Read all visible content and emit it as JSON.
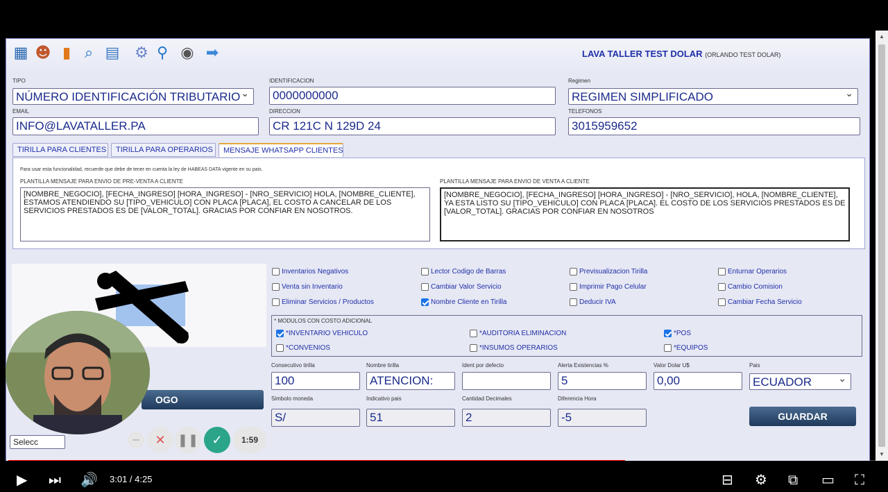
{
  "brand": {
    "title": "LAVA TALLER TEST DOLAR",
    "subtitle": "(ORLANDO TEST DOLAR)"
  },
  "toolbar_icons": [
    "cash-register-icon",
    "users-icon",
    "chart-icon",
    "search-icon",
    "calendar-icon",
    "gear-icon",
    "zoom-icon",
    "user-icon",
    "arrow-right-icon"
  ],
  "form": {
    "tipo": {
      "label": "TIPO",
      "value": "NÚMERO IDENTIFICACIÓN TRIBUTARIO"
    },
    "identificacion": {
      "label": "IDENTIFICACION",
      "value": "0000000000"
    },
    "regimen": {
      "label": "Regimen",
      "value": "REGIMEN SIMPLIFICADO"
    },
    "email": {
      "label": "EMAIL",
      "value": "INFO@LAVATALLER.PA"
    },
    "direccion": {
      "label": "DIRECCION",
      "value": "CR 121C N 129D 24"
    },
    "telefonos": {
      "label": "TELEFONOS",
      "value": "3015959652"
    }
  },
  "tabs": [
    "TIRILLA PARA CLIENTES",
    "TIRILLA PARA OPERARIOS",
    "MENSAJE WHATSAPP CLIENTES"
  ],
  "whatsapp": {
    "notice": "Para usar esta funcionalidad, recuerde que debe de tener en cuenta la ley de HABEAS DATA vigente en su pais.",
    "preventa_label": "PLANTILLA MENSAJE PARA ENVIO DE PRE-VENTA A CLIENTE",
    "preventa_text": "[NOMBRE_NEGOCIO], [FECHA_INGRESO] [HORA_INGRESO] - [NRO_SERVICIO] HOLA, [NOMBRE_CLIENTE], ESTAMOS ATENDIENDO SU [TIPO_VEHICULO] CON PLACA [PLACA], EL COSTO A CANCELAR DE LOS SERVICIOS PRESTADOS ES DE [VALOR_TOTAL]. GRACIAS POR CONFIAR EN NOSOTROS.",
    "venta_label": "PLANTILLA MENSAJE PARA ENVIO DE VENTA A CLIENTE",
    "venta_text": "[NOMBRE_NEGOCIO], [FECHA_INGRESO] [HORA_INGRESO] - [NRO_SERVICIO], HOLA, [NOMBRE_CLIENTE], YA ESTA LISTO SU [TIPO_VEHICULO] CON PLACA [PLACA]. EL COSTO DE LOS SERVICIOS PRESTADOS ES DE [VALOR_TOTAL]. GRACIAS POR CONFIAR EN NOSOTROS"
  },
  "options": [
    {
      "label": "Inventarios Negativos",
      "checked": false
    },
    {
      "label": "Lector Codigo de Barras",
      "checked": false
    },
    {
      "label": "Previsualizacion Tirilla",
      "checked": false
    },
    {
      "label": "Enturnar Operarios",
      "checked": false
    },
    {
      "label": "Venta sin Inventario",
      "checked": false
    },
    {
      "label": "Cambiar Valor Servicio",
      "checked": false
    },
    {
      "label": "Imprimir Pago Celular",
      "checked": false
    },
    {
      "label": "Cambio Comision",
      "checked": false
    },
    {
      "label": "Eliminar Servicios / Productos",
      "checked": false
    },
    {
      "label": "Nombre Cliente en Tirilla",
      "checked": true
    },
    {
      "label": "Deducir IVA",
      "checked": false
    },
    {
      "label": "Cambiar Fecha Servicio",
      "checked": false
    }
  ],
  "modules": {
    "title": "* MODULOS CON COSTO ADICIONAL",
    "items": [
      {
        "label": "*INVENTARIO VEHICULO",
        "checked": true
      },
      {
        "label": "*AUDITORIA ELIMINACION",
        "checked": false
      },
      {
        "label": "*POS",
        "checked": true
      },
      {
        "label": "*CONVENIOS",
        "checked": false
      },
      {
        "label": "*INSUMOS OPERARIOS",
        "checked": false
      },
      {
        "label": "*EQUIPOS",
        "checked": false
      }
    ]
  },
  "config": {
    "consecutivo": {
      "label": "Consecutivo tirilla",
      "value": "100"
    },
    "nombre_tirilla": {
      "label": "Nombre tirilla",
      "value": "ATENCION:"
    },
    "ident_defecto": {
      "label": "Ident por defecto",
      "value": ""
    },
    "alerta": {
      "label": "Alerta Existencias %",
      "value": "5"
    },
    "dolar": {
      "label": "Valor Dolar U$",
      "value": "0,00"
    },
    "pais": {
      "label": "Pais",
      "value": "ECUADOR"
    },
    "simbolo": {
      "label": "Simbolo moneda",
      "value": "S/"
    },
    "indicativo": {
      "label": "Indicativo pais",
      "value": "51"
    },
    "decimales": {
      "label": "Cantidad Decimales",
      "value": "2"
    },
    "diferencia": {
      "label": "Diferencia Hora",
      "value": "-5"
    }
  },
  "buttons": {
    "guardar": "GUARDAR",
    "logo": "OGO",
    "select_partial": "Selecc"
  },
  "recorder": {
    "time": "1:59"
  },
  "player": {
    "time": "3:01 / 4:25",
    "progress": 0.708
  },
  "colors": {
    "accent": "#1f2fa8",
    "progress": "#ff0000",
    "button": "#1f3a5c"
  }
}
